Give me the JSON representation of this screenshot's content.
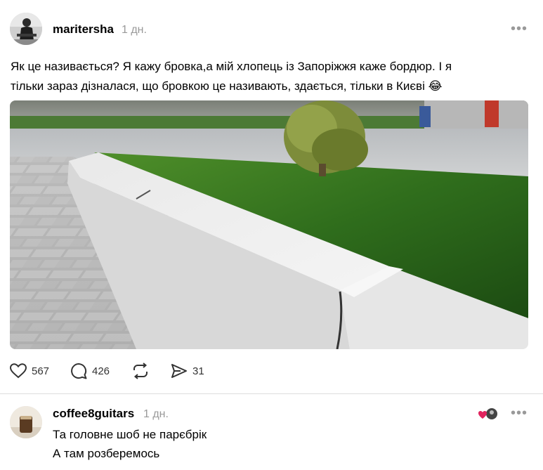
{
  "post": {
    "author": "maritersha",
    "time": "1 дн.",
    "text_line1": "Як це називається? Я кажу бровка,а мій хлопець із Запоріжжя каже бордюр. І я",
    "text_line2": "тільки зараз дізналася, що бровкою це називають, здається, тільки в Києві",
    "emoji": "😂",
    "likes": "567",
    "comments": "426",
    "shares": "31",
    "more": "•••"
  },
  "reply": {
    "author": "coffee8guitars",
    "time": "1 дн.",
    "line1": "Та головне шоб не парєбрік",
    "line2": "А там розберемось",
    "more": "•••"
  },
  "colors": {
    "text": "#000000",
    "muted": "#999999",
    "heart_red": "#e0245e"
  }
}
